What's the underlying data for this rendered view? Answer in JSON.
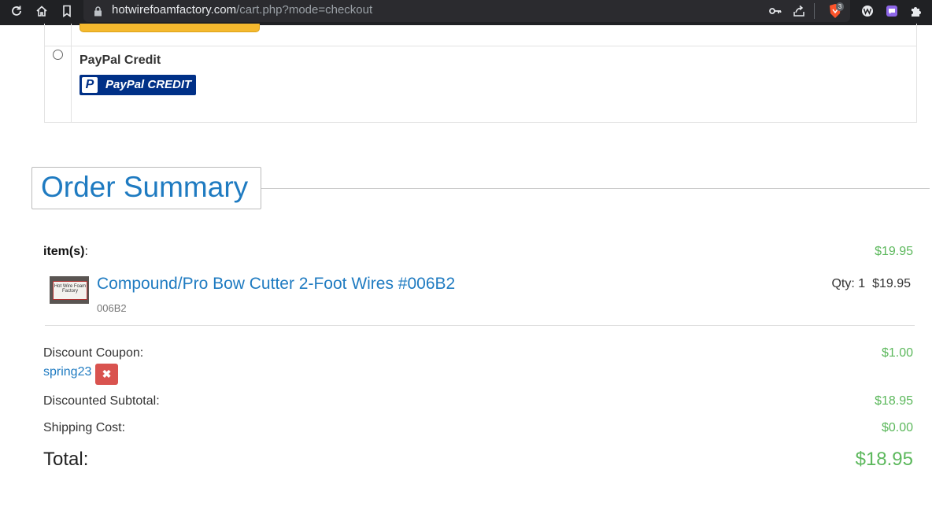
{
  "browser": {
    "url_host": "hotwirefoamfactory.com",
    "url_path": "/cart.php?mode=checkout",
    "extension_badge": "3",
    "icons": [
      "reload-icon",
      "home-icon",
      "bookmark-icon",
      "lock-icon",
      "key-icon",
      "share-icon",
      "brave-shield-icon",
      "extension-w-icon",
      "extension-chat-icon",
      "puzzle-icon"
    ]
  },
  "payment": {
    "paypal_credit_title": "PayPal Credit",
    "paypal_credit_logo": "PayPal CREDIT"
  },
  "summary": {
    "heading": "Order Summary",
    "items_label": "item(s)",
    "items_label_suffix": ":",
    "items_total": "$19.95",
    "product": {
      "name": "Compound/Pro Bow Cutter 2-Foot Wires #006B2",
      "sku": "006B2",
      "qty_text": "Qty: 1",
      "price": "$19.95",
      "thumb_text": "Hot Wire Foam Factory"
    },
    "discount_label": "Discount Coupon:",
    "discount_amount": "$1.00",
    "coupon_code": "spring23",
    "remove_icon": "✖",
    "subtotal_label": "Discounted Subtotal:",
    "subtotal_amount": "$18.95",
    "shipping_label": "Shipping Cost:",
    "shipping_amount": "$0.00",
    "total_label": "Total:",
    "total_amount": "$18.95"
  },
  "colors": {
    "link": "#1f7bc1",
    "price_green": "#5cb85c",
    "remove_red": "#d9534f"
  }
}
